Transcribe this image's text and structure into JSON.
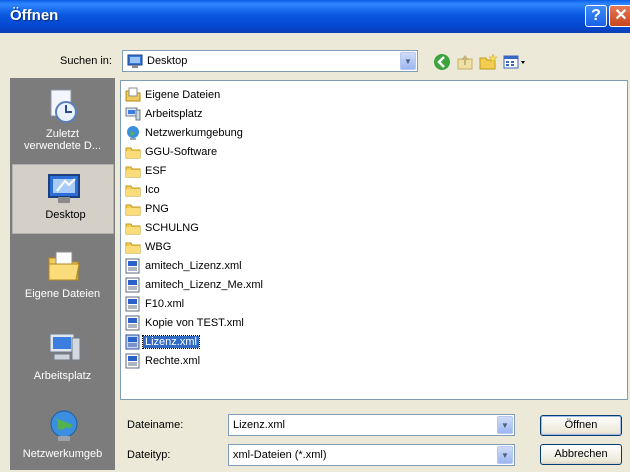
{
  "window": {
    "title": "Öffnen",
    "help_label": "?",
    "close_label": "✕"
  },
  "lookin": {
    "label": "Suchen in:",
    "value": "Desktop",
    "icon": "desktop-icon"
  },
  "toolbar": {
    "back": "back-icon",
    "up": "up-folder-icon",
    "new_folder": "new-folder-icon",
    "views": "views-menu-icon"
  },
  "places": [
    {
      "label": "Zuletzt",
      "label2": "verwendete D...",
      "icon": "recent-documents-icon"
    },
    {
      "label": "Desktop",
      "icon": "desktop-icon",
      "selected": true
    },
    {
      "label": "Eigene Dateien",
      "icon": "my-documents-icon"
    },
    {
      "label": "Arbeitsplatz",
      "icon": "my-computer-icon"
    },
    {
      "label": "Netzwerkumgeb",
      "icon": "network-icon"
    }
  ],
  "files": [
    {
      "name": "Eigene Dateien",
      "type": "special-folder"
    },
    {
      "name": "Arbeitsplatz",
      "type": "computer"
    },
    {
      "name": "Netzwerkumgebung",
      "type": "network"
    },
    {
      "name": "GGU-Software",
      "type": "folder"
    },
    {
      "name": "ESF",
      "type": "folder"
    },
    {
      "name": "Ico",
      "type": "folder"
    },
    {
      "name": "PNG",
      "type": "folder"
    },
    {
      "name": "SCHULNG",
      "type": "folder"
    },
    {
      "name": "WBG",
      "type": "folder"
    },
    {
      "name": "amitech_Lizenz.xml",
      "type": "xml"
    },
    {
      "name": "amitech_Lizenz_Me.xml",
      "type": "xml"
    },
    {
      "name": "F10.xml",
      "type": "xml"
    },
    {
      "name": "Kopie von TEST.xml",
      "type": "xml"
    },
    {
      "name": "Lizenz.xml",
      "type": "xml",
      "selected": true
    },
    {
      "name": "Rechte.xml",
      "type": "xml"
    }
  ],
  "filename": {
    "label": "Dateiname:",
    "value": "Lizenz.xml"
  },
  "filetype": {
    "label": "Dateityp:",
    "value": "xml-Dateien (*.xml)"
  },
  "buttons": {
    "open": "Öffnen",
    "cancel": "Abbrechen"
  }
}
